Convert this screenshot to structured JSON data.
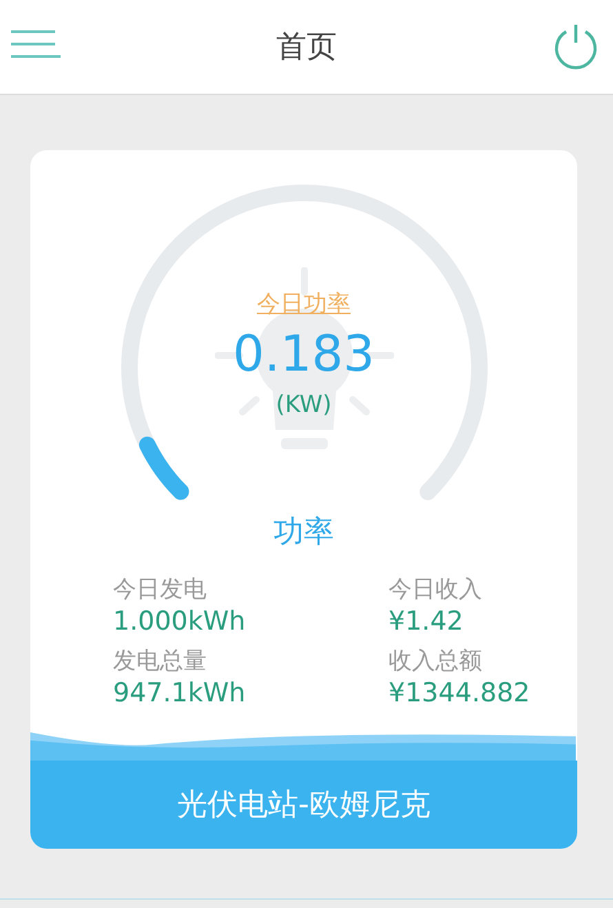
{
  "header": {
    "title": "首页"
  },
  "gauge": {
    "caption": "今日功率",
    "value": "0.183",
    "unit": "(KW)",
    "label": "功率",
    "level": 0.07
  },
  "stats": [
    {
      "label": "今日发电",
      "value": "1.000kWh"
    },
    {
      "label": "今日收入",
      "value": "¥1.42"
    },
    {
      "label": "发电总量",
      "value": "947.1kWh"
    },
    {
      "label": "收入总额",
      "value": "¥1344.882"
    }
  ],
  "station": {
    "name": "光伏电站-欧姆尼克"
  }
}
